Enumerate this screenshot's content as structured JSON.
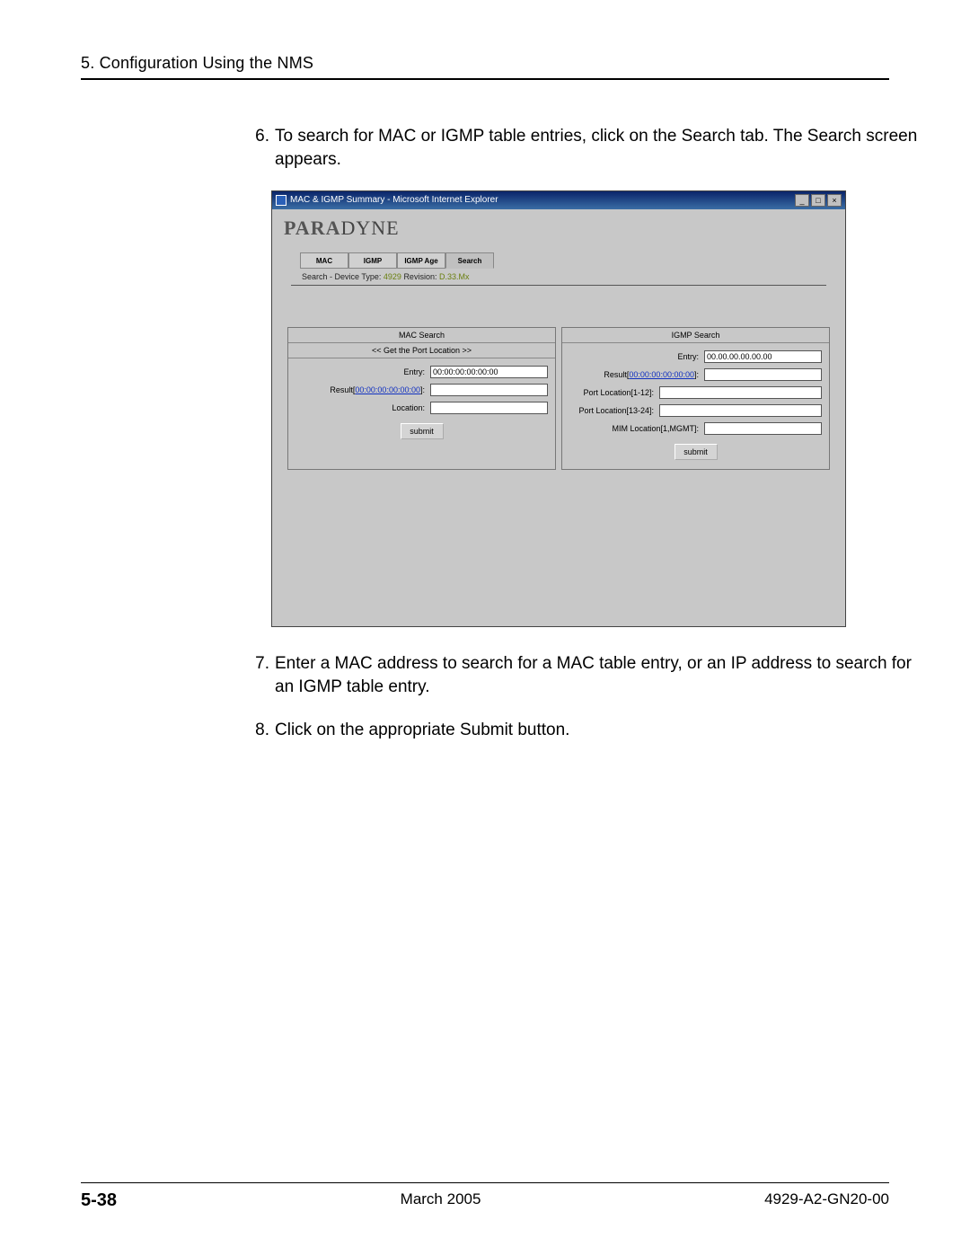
{
  "header": {
    "chapter": "5. Configuration Using the NMS"
  },
  "steps": {
    "s6": {
      "num": "6.",
      "text": "To search for MAC or IGMP table entries, click on the Search tab. The Search screen appears."
    },
    "s7": {
      "num": "7.",
      "text": "Enter a MAC address to search for a MAC table entry, or an IP address to search for an IGMP table entry."
    },
    "s8": {
      "num": "8.",
      "text": "Click on the appropriate Submit button."
    }
  },
  "window": {
    "title": "MAC & IGMP Summary - Microsoft Internet Explorer",
    "min": "_",
    "max": "□",
    "close": "×",
    "logo1": "PARA",
    "logo2": "DYNE",
    "tabs": {
      "mac": "MAC",
      "igmp": "IGMP",
      "age": "IGMP Age",
      "search": "Search"
    },
    "crumb": {
      "lbl1": "Search - ",
      "lbl2": "Device Type: ",
      "val2": "4929",
      "lbl3": "   Revision: ",
      "val3": "D.33.Mx"
    },
    "mac_panel": {
      "title": "MAC Search",
      "subtitle": "<< Get the Port Location >>",
      "entry_lbl": "Entry:",
      "entry_val": "00:00:00:00:00:00",
      "result_lbl_a": "Result[",
      "result_link": "00:00:00:00:00:00",
      "result_lbl_b": "]:",
      "location_lbl": "Location:",
      "submit": "submit"
    },
    "igmp_panel": {
      "title": "IGMP Search",
      "entry_lbl": "Entry:",
      "entry_val": "00.00.00.00.00.00",
      "result_lbl_a": "Result[",
      "result_link": "00:00:00:00:00:00",
      "result_lbl_b": "]:",
      "port1_lbl": "Port Location[1-12]:",
      "port2_lbl": "Port Location[13-24]:",
      "mim_lbl": "MIM Location[1,MGMT]:",
      "submit": "submit"
    }
  },
  "footer": {
    "page": "5-38",
    "date": "March 2005",
    "doc": "4929-A2-GN20-00"
  }
}
